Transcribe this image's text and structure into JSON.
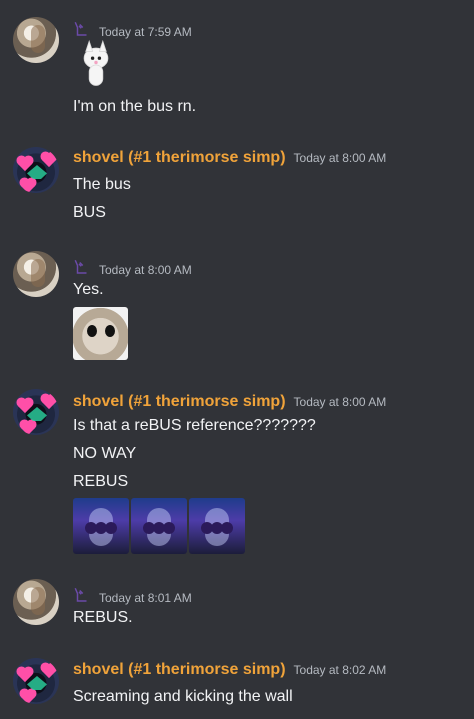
{
  "colors": {
    "background": "#313338",
    "text": "#f2f3f5",
    "muted": "#b5bac1",
    "username": "#f0a33a"
  },
  "messages": [
    {
      "author": "",
      "timestamp": "Today at 7:59 AM",
      "lines": [
        "I'm on the bus rn."
      ]
    },
    {
      "author": "shovel (#1 therimorse simp)",
      "timestamp": "Today at 8:00 AM",
      "lines": [
        "The bus",
        "BUS"
      ]
    },
    {
      "author": "",
      "timestamp": "Today at 8:00 AM",
      "lines": [
        "Yes."
      ]
    },
    {
      "author": "shovel (#1 therimorse simp)",
      "timestamp": "Today at 8:00 AM",
      "lines": [
        "Is that a reBUS reference???????",
        "NO WAY",
        "REBUS"
      ]
    },
    {
      "author": "",
      "timestamp": "Today at 8:01 AM",
      "lines": [
        "REBUS."
      ]
    },
    {
      "author": "shovel (#1 therimorse simp)",
      "timestamp": "Today at 8:02 AM",
      "lines": [
        "Screaming and kicking the wall"
      ]
    }
  ]
}
